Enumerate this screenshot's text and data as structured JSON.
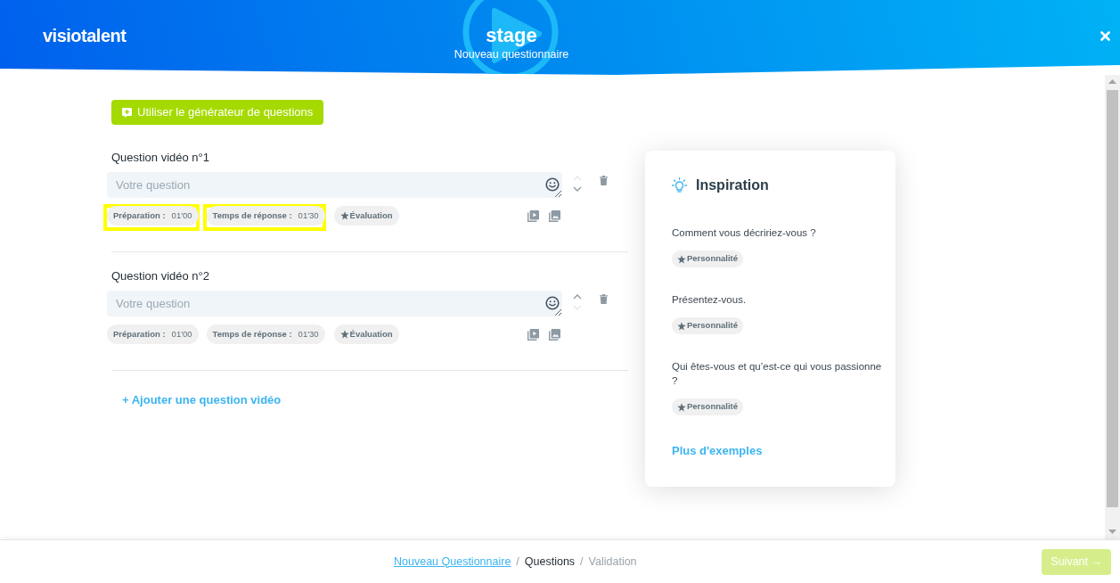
{
  "header": {
    "logo": "visiotalent",
    "title": "stage",
    "subtitle": "Nouveau questionnaire"
  },
  "generator_button": {
    "label": "Utiliser le générateur de questions"
  },
  "questions": [
    {
      "label": "Question vidéo n°1",
      "placeholder": "Votre question",
      "move_up": {
        "disabled": true
      },
      "move_down": {
        "disabled": false
      },
      "chips": [
        {
          "kind": "timer",
          "label": "Préparation :",
          "value": "01'00",
          "highlighted": true
        },
        {
          "kind": "timer",
          "label": "Temps de réponse :",
          "value": "01'30",
          "highlighted": true
        },
        {
          "kind": "tag",
          "label": "Évaluation",
          "highlighted": false
        }
      ]
    },
    {
      "label": "Question vidéo n°2",
      "placeholder": "Votre question",
      "move_up": {
        "disabled": false
      },
      "move_down": {
        "disabled": true
      },
      "chips": [
        {
          "kind": "timer",
          "label": "Préparation :",
          "value": "01'00",
          "highlighted": false
        },
        {
          "kind": "timer",
          "label": "Temps de réponse :",
          "value": "01'30",
          "highlighted": false
        },
        {
          "kind": "tag",
          "label": "Évaluation",
          "highlighted": false
        }
      ]
    }
  ],
  "add_question": {
    "label": "+ Ajouter une question vidéo"
  },
  "inspiration": {
    "title": "Inspiration",
    "examples": [
      {
        "text": "Comment vous décririez-vous ?",
        "tag": "Personnalité"
      },
      {
        "text": "Présentez-vous.",
        "tag": "Personnalité"
      },
      {
        "text": "Qui êtes-vous et qu’est-ce qui vous passionne ?",
        "tag": "Personnalité"
      }
    ],
    "more_link": "Plus d'exemples"
  },
  "footer": {
    "breadcrumb": [
      {
        "label": "Nouveau Questionnaire",
        "completed": true,
        "selected": false
      },
      {
        "separator": "/",
        "label": "Questions",
        "completed": false,
        "selected": true
      },
      {
        "separator": "/",
        "label": "Validation",
        "completed": false,
        "selected": false
      }
    ],
    "next_button": {
      "label": "Suivant →",
      "disabled": true
    }
  }
}
